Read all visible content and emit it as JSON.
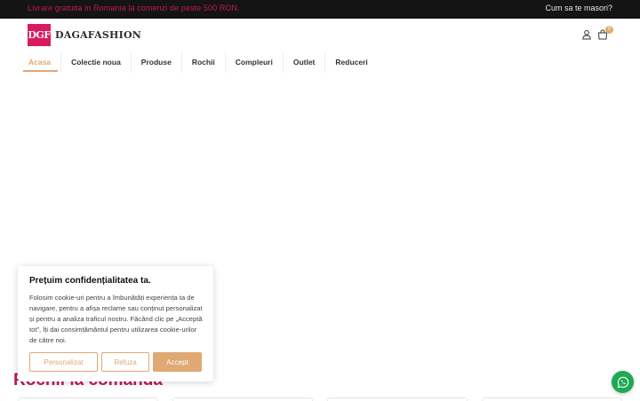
{
  "topbar": {
    "promo": "Livrare gratuita in Romania la comenzi de peste 500 RON.",
    "size_link": "Cum sa te masori?"
  },
  "brand": {
    "logo_mark": "DGF",
    "logo_text": "DAGAFASHION"
  },
  "header": {
    "cart_count": "0"
  },
  "nav": {
    "items": [
      {
        "label": "Acasa",
        "active": true
      },
      {
        "label": "Colectie noua",
        "active": false
      },
      {
        "label": "Produse",
        "active": false
      },
      {
        "label": "Rochii",
        "active": false
      },
      {
        "label": "Compleuri",
        "active": false
      },
      {
        "label": "Outlet",
        "active": false
      },
      {
        "label": "Reduceri",
        "active": false
      }
    ]
  },
  "section": {
    "title": "Rochii la comanda"
  },
  "cookie": {
    "title": "Prețuim confidențialitatea ta.",
    "body": "Folosim cookie-uri pentru a îmbunătăți experiența ta de navigare, pentru a afișa reclame sau conținut personalizat și pentru a analiza traficul nostru. Făcând clic pe „Acceptă tot”, îți dai consimțământul pentru utilizarea cookie-urilor de către noi.",
    "btn_customize": "Personalizat",
    "btn_reject": "Refuza",
    "btn_accept": "Accept"
  },
  "colors": {
    "brand_pink": "#d81b60",
    "accent_gold": "#e0a872",
    "whatsapp_green": "#1ea952",
    "topbar_bg": "#141414"
  },
  "icons": {
    "account": "user-icon",
    "cart": "shopping-bag-icon",
    "chat": "whatsapp-icon"
  }
}
